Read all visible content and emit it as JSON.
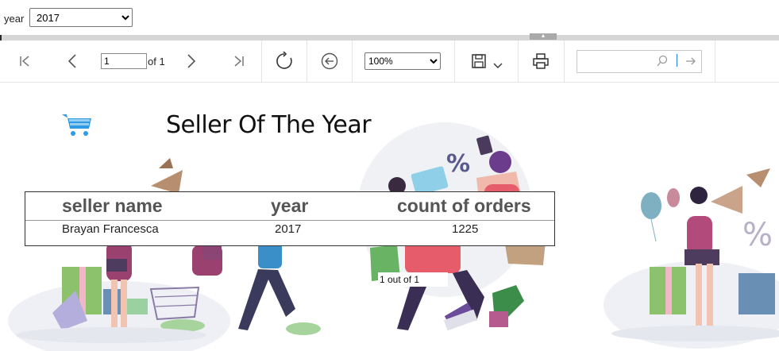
{
  "params": {
    "year_label": "year",
    "year_value": "2017"
  },
  "toolbar": {
    "page_value": "1",
    "page_of": "of 1",
    "zoom_value": "100%",
    "find_placeholder": "",
    "icons": [
      "first-page-icon",
      "prev-page-icon",
      "next-page-icon",
      "last-page-icon",
      "refresh-icon",
      "back-icon",
      "save-icon",
      "chevron-down-icon",
      "print-icon",
      "search-icon",
      "find-next-icon"
    ]
  },
  "report": {
    "title": "Seller Of The Year",
    "columns": [
      "seller name",
      "year",
      "count of orders"
    ],
    "rows": [
      [
        "Brayan Francesca",
        "2017",
        "1225"
      ]
    ],
    "pager": "1 out of 1"
  },
  "colors": {
    "cart": "#2f9be3",
    "header_text": "#555555",
    "splitter": "#d6d6d6"
  }
}
